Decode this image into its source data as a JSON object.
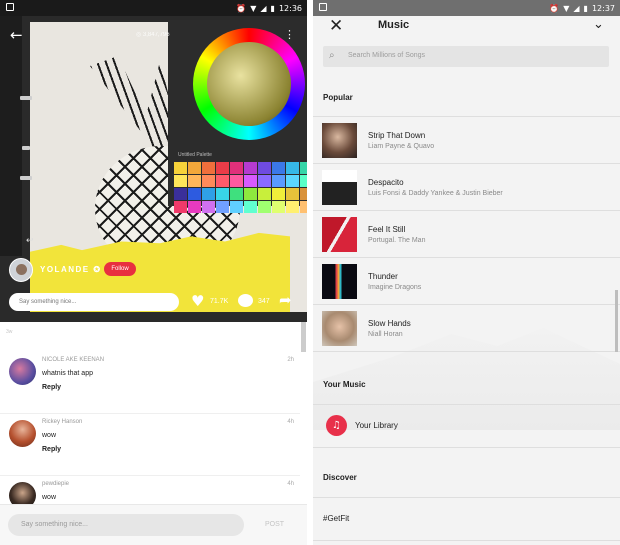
{
  "left": {
    "status_time": "12:36",
    "host_name": "YOLANDE",
    "follow_label": "Follow",
    "say_placeholder": "Say something nice...",
    "likes": "71.7K",
    "comments_count": "347",
    "palette_title": "Untitled Palette",
    "first_timestamp": "3w",
    "comments": [
      {
        "name": "NICOLE AKE KEENAN",
        "text": "whatnis that app",
        "reply": "Reply",
        "age": "2h"
      },
      {
        "name": "Rickey Hanson",
        "text": "wow",
        "reply": "Reply",
        "age": "4h"
      },
      {
        "name": "pewdiepie",
        "text": "wow",
        "reply": "",
        "age": "4h"
      }
    ],
    "bottom_placeholder": "Say something nice...",
    "post_label": "POST",
    "swatch_colors": [
      "#f7d23a",
      "#f2a73a",
      "#ef6f3c",
      "#ea3c48",
      "#e0307a",
      "#b63bd0",
      "#6f4be0",
      "#3b78e8",
      "#36b8e8",
      "#36d6a8",
      "#ffe65a",
      "#ffb65a",
      "#ff8a5a",
      "#ff5a6a",
      "#ff5aa0",
      "#d85aff",
      "#8a6aff",
      "#5a9aff",
      "#5ad6ff",
      "#5affc8",
      "#3a2f9a",
      "#2d5be0",
      "#2fa0e6",
      "#38d5e8",
      "#3fe07e",
      "#8ee83e",
      "#c8ef3b",
      "#f0ef3a",
      "#e6c33a",
      "#d9923a",
      "#f03a6a",
      "#e83ac0",
      "#d070f0",
      "#70a0ff",
      "#60d0ff",
      "#60ffd0",
      "#a0ff70",
      "#e0ff70",
      "#fff070",
      "#ffc070"
    ]
  },
  "right": {
    "status_time": "12:37",
    "title": "Music",
    "search_placeholder": "Search Millions of Songs",
    "popular_heading": "Popular",
    "songs": [
      {
        "title": "Strip That Down",
        "artist": "Liam Payne & Quavo"
      },
      {
        "title": "Despacito",
        "artist": "Luis Fonsi & Daddy Yankee & Justin Bieber"
      },
      {
        "title": "Feel It Still",
        "artist": "Portugal. The Man"
      },
      {
        "title": "Thunder",
        "artist": "Imagine Dragons"
      },
      {
        "title": "Slow Hands",
        "artist": "Niall Horan"
      }
    ],
    "your_music_heading": "Your Music",
    "library_label": "Your Library",
    "discover_heading": "Discover",
    "discover_item": "#GetFit"
  },
  "colors": {
    "follow_red": "#e8303f",
    "library_red": "#e8304a"
  }
}
